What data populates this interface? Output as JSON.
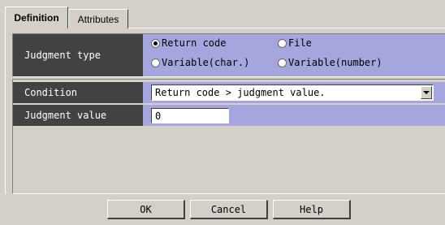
{
  "tabs": [
    {
      "label": "Definition",
      "active": true
    },
    {
      "label": "Attributes",
      "active": false
    }
  ],
  "judgment_type": {
    "label": "Judgment type",
    "options": [
      {
        "label": "Return code",
        "selected": true
      },
      {
        "label": "File",
        "selected": false
      },
      {
        "label": "Variable(char.)",
        "selected": false
      },
      {
        "label": "Variable(number)",
        "selected": false
      }
    ]
  },
  "condition": {
    "label": "Condition",
    "selected": "Return code > judgment value."
  },
  "judgment_value": {
    "label": "Judgment value",
    "value": "0"
  },
  "buttons": {
    "ok": "OK",
    "cancel": "Cancel",
    "help": "Help"
  },
  "colors": {
    "label_bg": "#424242",
    "value_bg": "#a5a6dd",
    "dialog_bg": "#d4d0c8"
  }
}
